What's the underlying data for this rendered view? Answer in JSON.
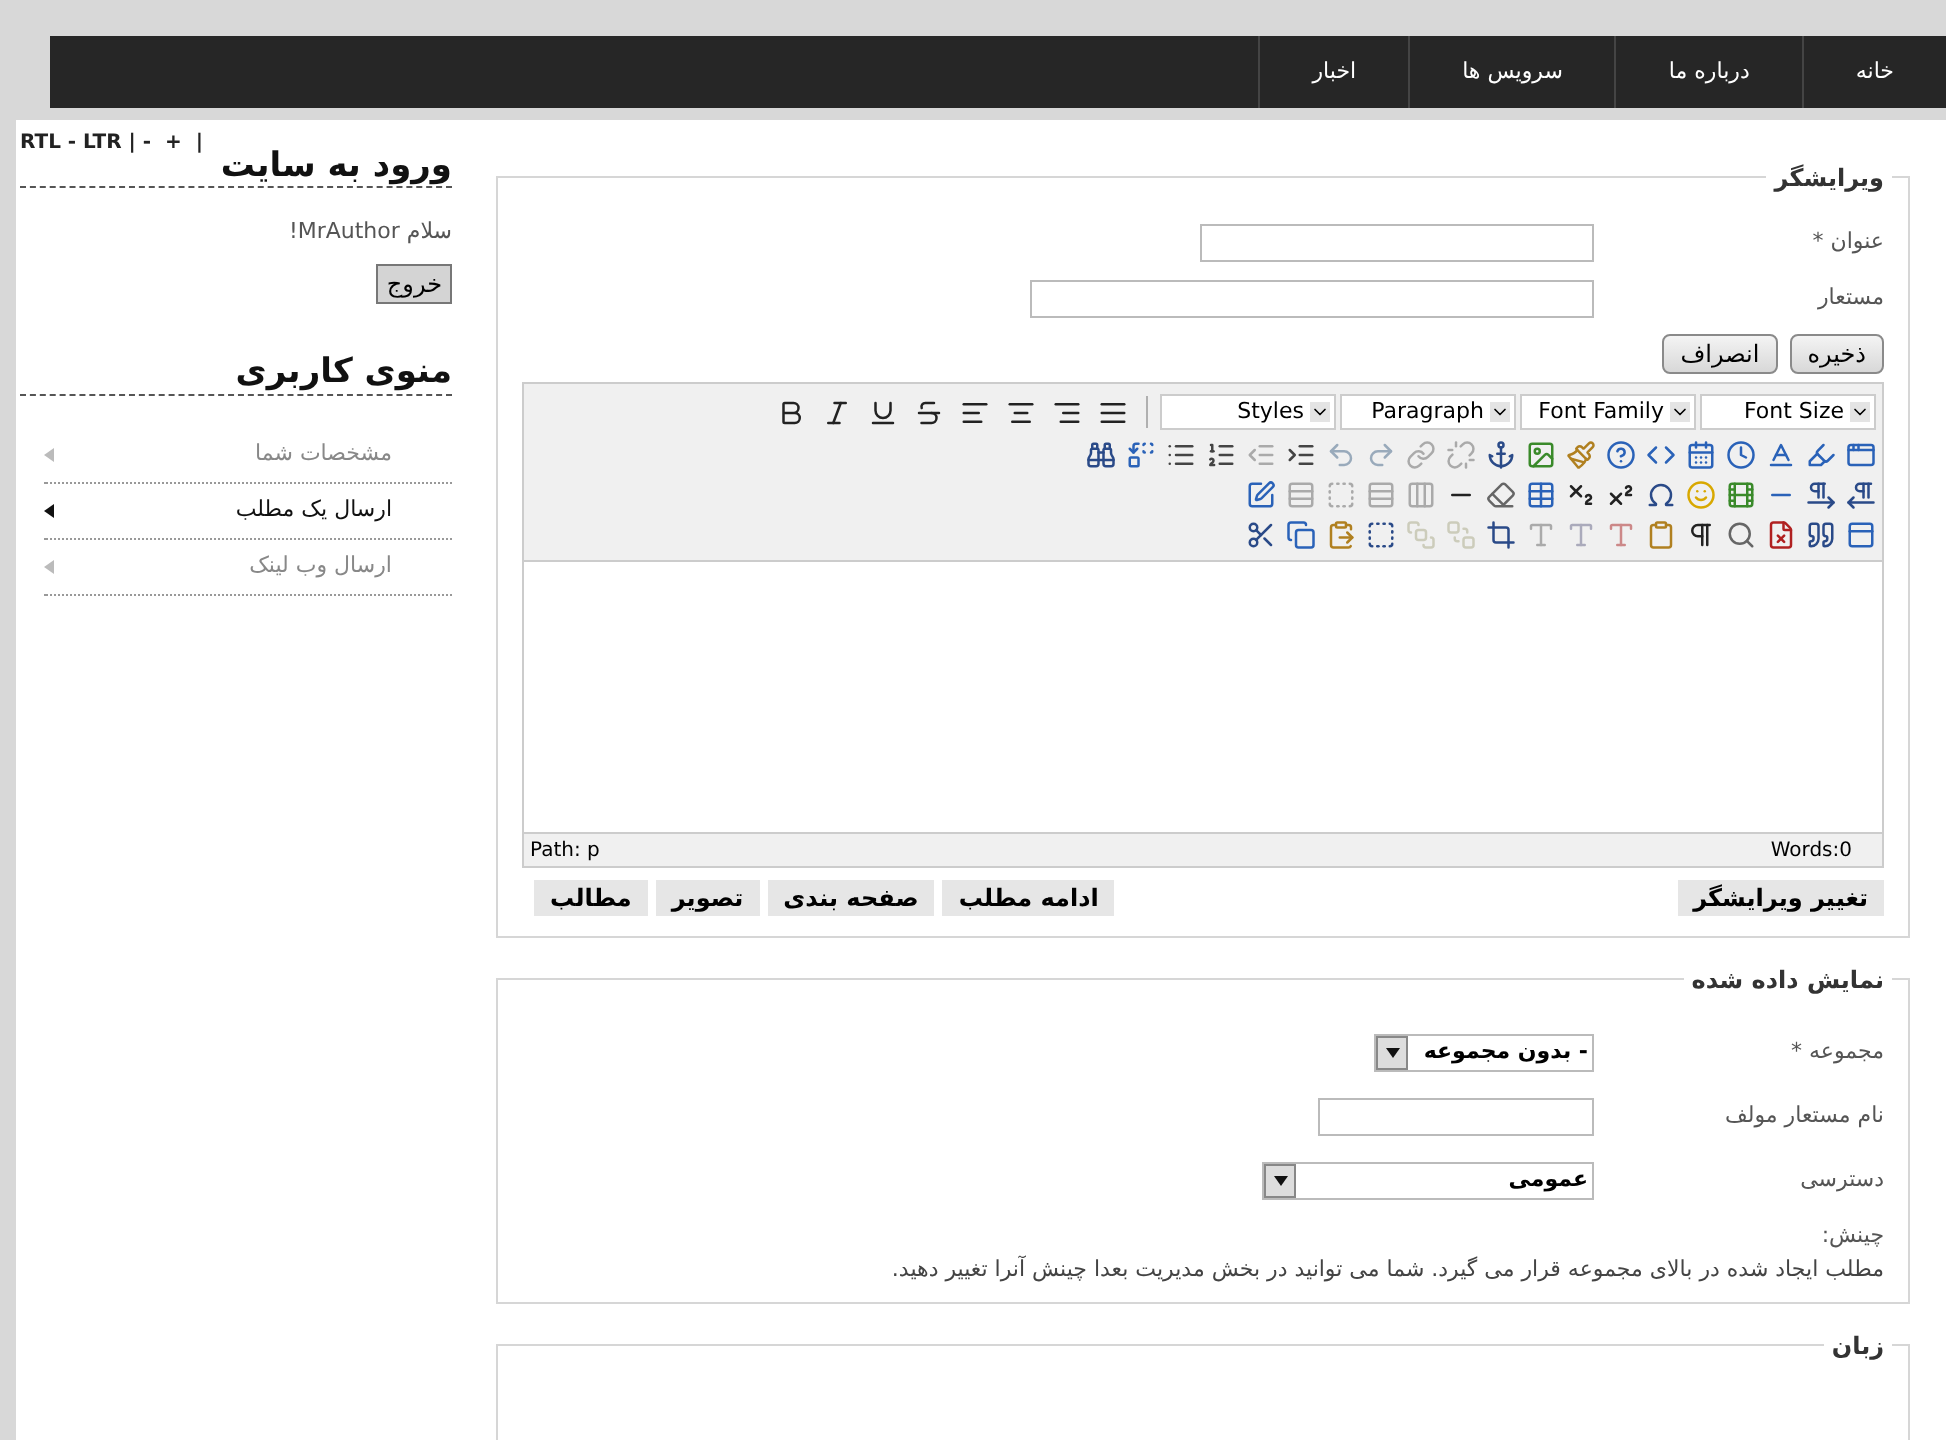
{
  "nav": {
    "items": [
      {
        "label": "خانه"
      },
      {
        "label": "درباره ما"
      },
      {
        "label": "سرویس ها"
      },
      {
        "label": "اخبار"
      }
    ]
  },
  "sidebar": {
    "direction_links": [
      "RTL - LTR | -  +  |"
    ],
    "login": {
      "title": "ورود به سایت",
      "greeting": "سلام MrAuthor!",
      "logout_button": "خروج"
    },
    "user_menu": {
      "title": "منوی کاربری",
      "items": [
        {
          "label": "مشخصات شما",
          "selected": false
        },
        {
          "label": "ارسال یک مطلب",
          "selected": true
        },
        {
          "label": "ارسال وب لینک",
          "selected": false
        }
      ]
    }
  },
  "editor_section": {
    "legend": "ویرایشگر",
    "fields": [
      {
        "label": "عنوان *",
        "kind": "short"
      },
      {
        "label": "مستعار",
        "kind": "long"
      }
    ],
    "buttons": [
      "ذخیره",
      "انصراف"
    ],
    "editor": {
      "selects": [
        "Font Size",
        "Font Family",
        "Paragraph",
        "Styles"
      ],
      "path": "Path: p",
      "words": "Words:0"
    },
    "toggle_button": "تغییر ویرایشگر",
    "insert_buttons": [
      "ادامه مطلب",
      "صفحه بندی",
      "تصویر",
      "مطالب"
    ]
  },
  "display_section": {
    "legend": "نمایش داده شده",
    "fields": [
      {
        "label": "مجموعه *",
        "kind": "select",
        "value": "- بدون مجموعه"
      },
      {
        "label": "نام مستعار مولف",
        "kind": "input"
      },
      {
        "label": "دسترسی",
        "kind": "wide-select",
        "value": "عمومی"
      }
    ],
    "order_label": "چینش:",
    "order_note": "مطلب ایجاد شده در بالای مجموعه قرار می گیرد. شما می توانید در بخش مدیریت بعدا چینش آنرا تغییر دهید."
  },
  "language_section": {
    "legend": "زبان"
  }
}
